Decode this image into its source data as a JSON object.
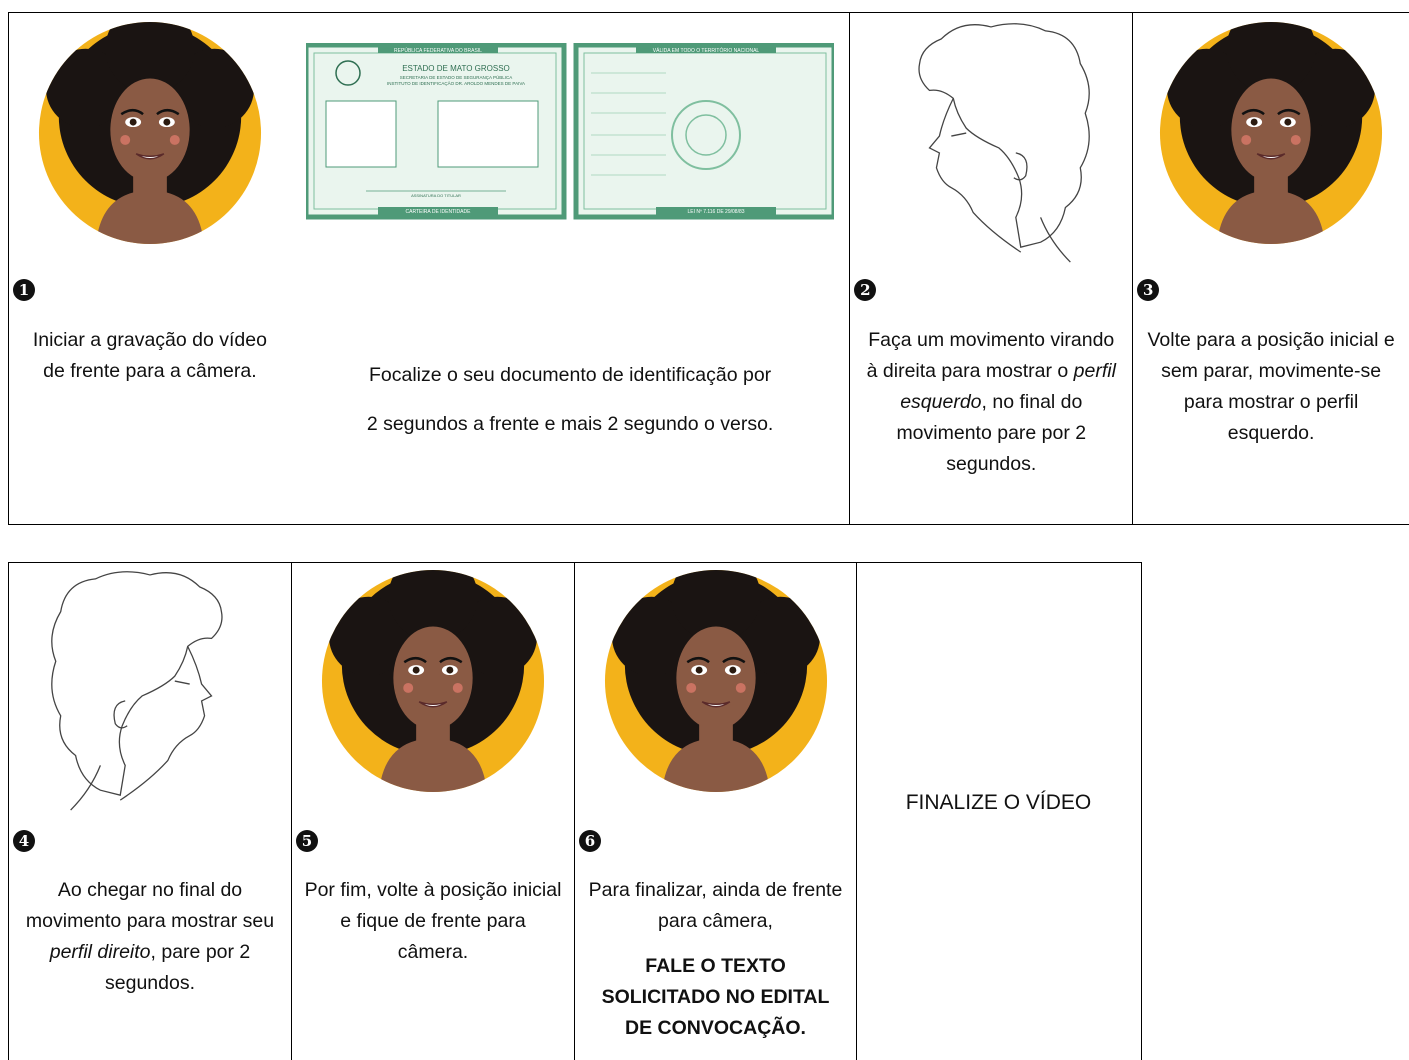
{
  "steps": {
    "step1": {
      "number": "1",
      "text": "Iniciar a gravação do vídeo de frente para a câmera."
    },
    "doc": {
      "line1": "Focalize o seu documento de identificação por",
      "line2": "2 segundos a frente e mais 2 segundo o verso.",
      "front": {
        "header": "REPÚBLICA FEDERATIVA DO BRASIL",
        "title": "ESTADO DE MATO GROSSO",
        "sub1": "SECRETARIA DE ESTADO DE SEGURANÇA PÚBLICA",
        "sub2": "INSTITUTO DE IDENTIFICAÇÃO DR. AROLDO MENDES DE PAIVA",
        "signature": "ASSINATURA DO TITULAR",
        "footer": "CARTEIRA DE IDENTIDADE"
      },
      "back": {
        "header": "VÁLIDA EM TODO O TERRITÓRIO NACIONAL",
        "footer": "LEI Nº 7.116 DE 29/08/83"
      }
    },
    "step2": {
      "number": "2",
      "pre": "Faça um movimento virando à direita para mostrar o ",
      "em": "perfil esquerdo",
      "post": ", no final do movimento pare por 2 segundos."
    },
    "step3": {
      "number": "3",
      "text": "Volte para a posição inicial e sem parar, movimente-se para mostrar o perfil esquerdo."
    },
    "step4": {
      "number": "4",
      "pre": "Ao chegar no final do movimento para mostrar seu ",
      "em": "perfil direito",
      "post": ", pare por 2 segundos."
    },
    "step5": {
      "number": "5",
      "text": "Por fim, volte à posição inicial e fique de frente para câmera."
    },
    "step6": {
      "number": "6",
      "text": "Para finalizar, ainda de frente para câmera,",
      "bold": "FALE O TEXTO SOLICITADO NO EDITAL DE CONVOCAÇÃO."
    },
    "final": {
      "text": "FINALIZE O VÍDEO"
    }
  },
  "colors": {
    "yellow": "#f3b21a",
    "hair": "#1a1412",
    "skin": "#8a5a44",
    "card": "#7fbf9f",
    "border": "#000000"
  }
}
